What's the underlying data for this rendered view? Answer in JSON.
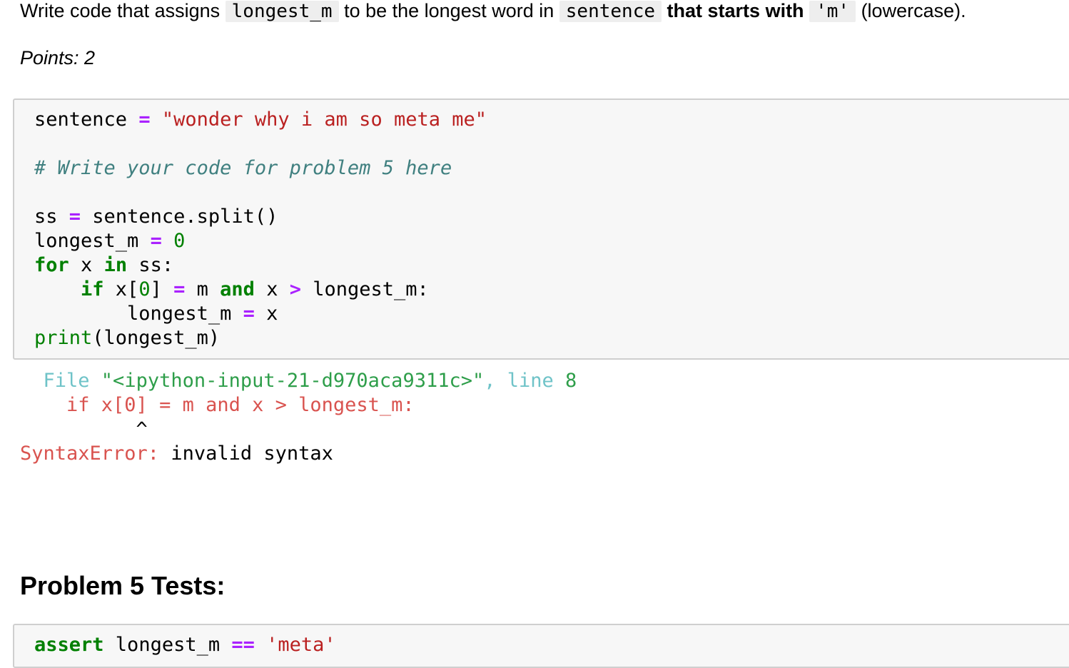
{
  "instruction": {
    "t1": "Write code that assigns",
    "code1": "longest_m",
    "t2": "to be the longest word in",
    "code2": "sentence",
    "bold": "that starts with",
    "code3": "'m'",
    "t3": "(lowercase)."
  },
  "points": "Points: 2",
  "code": {
    "l1_a": "sentence ",
    "l1_op": "=",
    "l1_sp": " ",
    "l1_str": "\"wonder why i am so meta me\"",
    "l3_comment": "# Write your code for problem 5 here",
    "l5_a": "ss ",
    "l5_op": "=",
    "l5_b": " sentence.split()",
    "l6_a": "longest_m ",
    "l6_op": "=",
    "l6_sp": " ",
    "l6_num": "0",
    "l7_kw1": "for",
    "l7_a": " x ",
    "l7_kw2": "in",
    "l7_b": " ss:",
    "l8_ind": "    ",
    "l8_kw1": "if",
    "l8_a": " x[",
    "l8_num": "0",
    "l8_b": "] ",
    "l8_op1": "=",
    "l8_c": " m ",
    "l8_kw2": "and",
    "l8_d": " x ",
    "l8_op2": ">",
    "l8_e": " longest_m:",
    "l9_a": "        longest_m ",
    "l9_op": "=",
    "l9_b": " x",
    "l10_bi": "print",
    "l10_a": "(longest_m)"
  },
  "error": {
    "file_kw": "  File",
    "file_path": " \"<ipython-input-21-d970aca9311c>\"",
    "comma": ",",
    "line_kw": " line",
    "line_num": " 8",
    "source": "    if x[0] = m and x > longest_m:",
    "caret": "          ^",
    "err_name": "SyntaxError:",
    "err_msg": " invalid syntax"
  },
  "tests_heading": "Problem 5 Tests:",
  "test_code": {
    "kw": "assert",
    "a": " longest_m ",
    "op": "==",
    "sp": " ",
    "str": "'meta'"
  }
}
